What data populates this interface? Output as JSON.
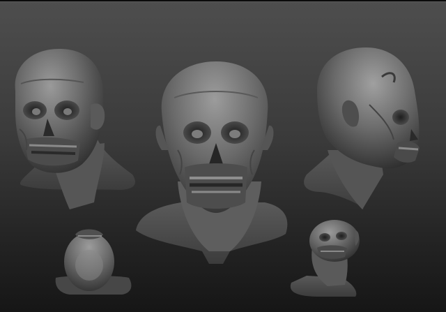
{
  "scene": {
    "background_top": "#4e4e4e",
    "background_bottom": "#161616",
    "material_color": "#6e6e6e",
    "views": [
      {
        "name": "three-quarter-left"
      },
      {
        "name": "front"
      },
      {
        "name": "profile-right"
      },
      {
        "name": "top"
      },
      {
        "name": "low-angle-three-quarter"
      }
    ]
  }
}
